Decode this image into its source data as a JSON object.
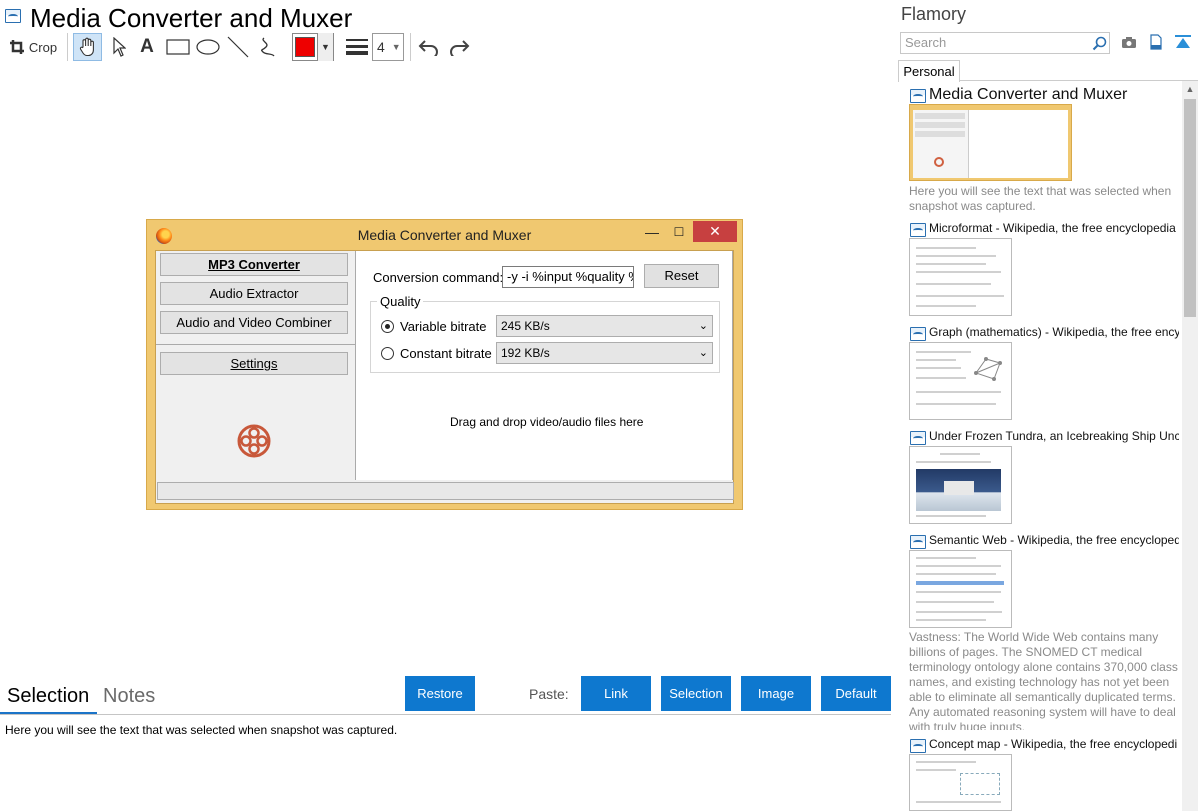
{
  "app": {
    "title": "Media Converter and Muxer"
  },
  "toolbar": {
    "crop_label": "Crop",
    "tools": [
      "hand-icon",
      "pointer-icon",
      "text-icon",
      "rectangle-icon",
      "ellipse-icon",
      "line-icon",
      "freehand-icon"
    ],
    "color": "#ee0000",
    "line_width": "4"
  },
  "capture": {
    "window_title": "Media Converter and Muxer",
    "nav": {
      "mp3": "MP3 Converter",
      "audio": "Audio Extractor",
      "combiner": "Audio and Video Combiner",
      "settings": "Settings"
    },
    "conversion_label": "Conversion command:",
    "conversion_value": "-y -i %input %quality %",
    "reset": "Reset",
    "quality_label": "Quality",
    "variable_label": "Variable bitrate",
    "variable_value": "245 KB/s",
    "constant_label": "Constant bitrate",
    "constant_value": "192 KB/s",
    "drop_text": "Drag and drop video/audio files here",
    "accent_color": "#f0c870"
  },
  "bottom": {
    "tab_selection": "Selection",
    "tab_notes": "Notes",
    "restore": "Restore",
    "paste_label": "Paste:",
    "paste_buttons": [
      "Link",
      "Selection",
      "Image",
      "Default"
    ],
    "selection_text": "Here you will see the text that was selected when snapshot was captured.",
    "button_color": "#0e78cf"
  },
  "sidebar": {
    "app_name": "Flamory",
    "search_placeholder": "Search",
    "tab": "Personal",
    "snapshots": [
      {
        "title": "Media Converter and Muxer",
        "desc": "Here you will see the text that was selected when snapshot was captured."
      },
      {
        "title": "Microformat - Wikipedia, the free encyclopedia"
      },
      {
        "title": "Graph (mathematics) - Wikipedia, the free ency"
      },
      {
        "title": "Under Frozen Tundra, an Icebreaking Ship Unco"
      },
      {
        "title": "Semantic Web - Wikipedia, the free encycloped",
        "desc": "Vastness: The World Wide Web contains many billions of pages. The SNOMED CT medical terminology ontology alone contains 370,000 class names, and existing technology has not yet been able to eliminate all semantically duplicated terms. Any automated reasoning system will have to deal with truly huge inputs."
      },
      {
        "title": "Concept map - Wikipedia, the free encyclopedi"
      }
    ]
  }
}
